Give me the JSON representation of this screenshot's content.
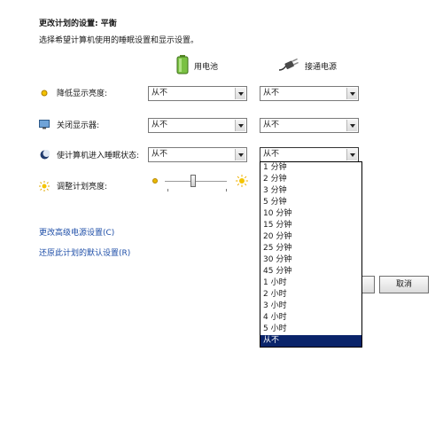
{
  "header": {
    "title": "更改计划的设置: 平衡",
    "subtitle": "选择希望计算机使用的睡眠设置和显示设置。"
  },
  "columns": {
    "battery_label": "用电池",
    "plugged_label": "接通电源"
  },
  "rows": [
    {
      "label": "降低显示亮度:",
      "battery": "从不",
      "plugged": "从不"
    },
    {
      "label": "关闭显示器:",
      "battery": "从不",
      "plugged": "从不"
    },
    {
      "label": "使计算机进入睡眠状态:",
      "battery": "从不",
      "plugged": "从不"
    }
  ],
  "brightness": {
    "label": "调整计划亮度:"
  },
  "dropdown": {
    "options": [
      "1 分钟",
      "2 分钟",
      "3 分钟",
      "5 分钟",
      "10 分钟",
      "15 分钟",
      "20 分钟",
      "25 分钟",
      "30 分钟",
      "45 分钟",
      "1 小时",
      "2 小时",
      "3 小时",
      "4 小时",
      "5 小时",
      "从不"
    ],
    "selected": "从不"
  },
  "links": {
    "advanced": "更改高级电源设置(C)",
    "restore": "还原此计划的默认设置(R)"
  },
  "buttons": {
    "cancel": "取消"
  },
  "colors": {
    "link": "#1f4fa8",
    "selection": "#0a246a"
  }
}
